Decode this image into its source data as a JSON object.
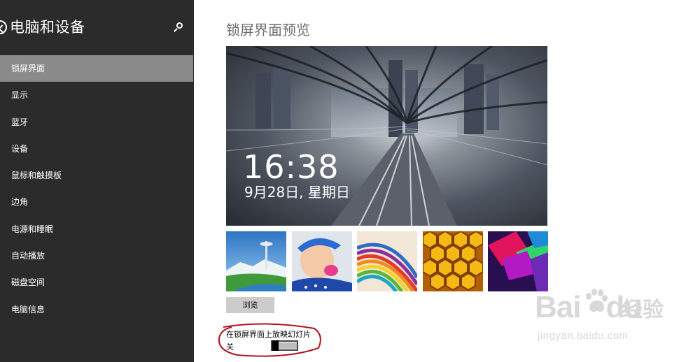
{
  "sidebar": {
    "title": "电脑和设备",
    "back_icon": "back-arrow-circle-icon",
    "search_icon": "search-icon",
    "items": [
      {
        "label": "锁屏界面",
        "active": true
      },
      {
        "label": "显示",
        "active": false
      },
      {
        "label": "蓝牙",
        "active": false
      },
      {
        "label": "设备",
        "active": false
      },
      {
        "label": "鼠标和触摸板",
        "active": false
      },
      {
        "label": "边角",
        "active": false
      },
      {
        "label": "电源和睡眠",
        "active": false
      },
      {
        "label": "自动播放",
        "active": false
      },
      {
        "label": "磁盘空间",
        "active": false
      },
      {
        "label": "电脑信息",
        "active": false
      }
    ]
  },
  "main": {
    "title": "锁屏界面预览",
    "preview": {
      "time": "16:38",
      "date": "9月28日, 星期日"
    },
    "thumbnails": [
      "space-needle-landscape",
      "baby-in-blue-hat",
      "colorful-curves",
      "honeycomb",
      "geometric-prism"
    ],
    "browse_label": "浏览",
    "slideshow": {
      "label": "在锁屏界面上放映幻灯片",
      "state": "关",
      "on": false
    }
  },
  "watermark": {
    "logo": "Bai",
    "logo_suffix": "du",
    "chinese": "经验",
    "url": "jingyan.baidu.com"
  },
  "colors": {
    "sidebar_bg": "#2b2b2b",
    "active_item_bg": "#8a8a8a",
    "annotation": "#b0141e"
  }
}
